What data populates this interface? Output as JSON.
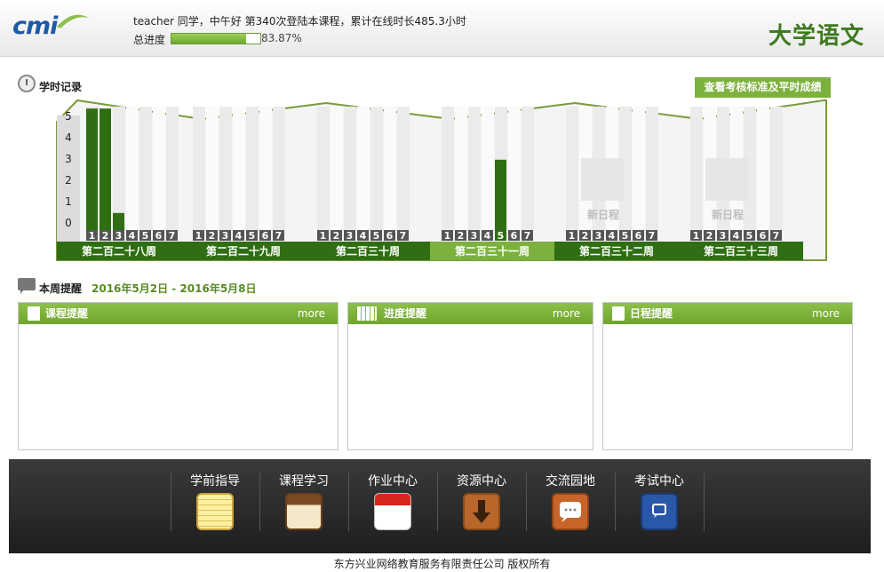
{
  "header": {
    "logo": "cmi",
    "greeting": "teacher 同学，中午好  第340次登陆本课程，累计在线时长485.3小时",
    "progress_label": "总进度",
    "progress_value": 0.8387,
    "progress_text": "83.87%",
    "course_title": "大学语文"
  },
  "study_record": {
    "title": "学时记录",
    "check_button": "查看考核标准及平时成绩"
  },
  "chart_data": {
    "type": "bar",
    "y_ticks": [
      "0",
      "1",
      "2",
      "3",
      "4",
      "5"
    ],
    "ylim": [
      0,
      5.5
    ],
    "weeks": [
      {
        "label": "第二百二十八周",
        "days": [
          "1",
          "2",
          "3",
          "4",
          "5",
          "6",
          "7"
        ],
        "values": [
          5.7,
          5.7,
          0.8,
          0,
          0,
          0,
          0
        ],
        "current": false,
        "highlight_day": null,
        "new_schedule": ""
      },
      {
        "label": "第二百二十九周",
        "days": [
          "1",
          "2",
          "3",
          "4",
          "5",
          "6",
          "7"
        ],
        "values": [
          0,
          0,
          0,
          0,
          0,
          0,
          0
        ],
        "current": false,
        "highlight_day": null,
        "new_schedule": ""
      },
      {
        "label": "第二百三十周",
        "days": [
          "1",
          "2",
          "3",
          "4",
          "5",
          "6",
          "7"
        ],
        "values": [
          0,
          0,
          0,
          0,
          0,
          0,
          0
        ],
        "current": false,
        "highlight_day": null,
        "new_schedule": ""
      },
      {
        "label": "第二百三十一周",
        "days": [
          "1",
          "2",
          "3",
          "4",
          "5",
          "6",
          "7"
        ],
        "values": [
          0,
          0,
          0,
          0,
          3.3,
          0,
          0
        ],
        "current": true,
        "highlight_day": 5,
        "new_schedule": ""
      },
      {
        "label": "第二百三十二周",
        "days": [
          "1",
          "2",
          "3",
          "4",
          "5",
          "6",
          "7"
        ],
        "values": [
          0,
          0,
          0,
          0,
          0,
          0,
          0
        ],
        "current": false,
        "highlight_day": null,
        "new_schedule": "新日程"
      },
      {
        "label": "第二百三十三周",
        "days": [
          "1",
          "2",
          "3",
          "4",
          "5",
          "6",
          "7"
        ],
        "values": [
          0,
          0,
          0,
          0,
          0,
          0,
          0
        ],
        "current": false,
        "highlight_day": null,
        "new_schedule": "新日程"
      }
    ],
    "colors": {
      "bar": "#2f6e12",
      "week_bar": "#2f6e12",
      "current_week_bar": "#7cb13d"
    }
  },
  "reminders": {
    "title": "本周提醒",
    "date_range": "2016年5月2日   - 2016年5月8日",
    "panels": [
      {
        "title": "课程提醒",
        "more": "more",
        "icon": "document-icon"
      },
      {
        "title": "进度提醒",
        "more": "more",
        "icon": "calendar-icon"
      },
      {
        "title": "日程提醒",
        "more": "more",
        "icon": "note-icon"
      }
    ]
  },
  "nav": {
    "items": [
      {
        "label": "学前指导",
        "icon": "notepad-icon"
      },
      {
        "label": "课程学习",
        "icon": "notebook-icon"
      },
      {
        "label": "作业中心",
        "icon": "calendar-icon"
      },
      {
        "label": "资源中心",
        "icon": "download-icon"
      },
      {
        "label": "交流园地",
        "icon": "chat-icon"
      },
      {
        "label": "考试中心",
        "icon": "book-icon"
      }
    ]
  },
  "footer": {
    "copyright": "东方兴业网络教育服务有限责任公司        版权所有"
  }
}
